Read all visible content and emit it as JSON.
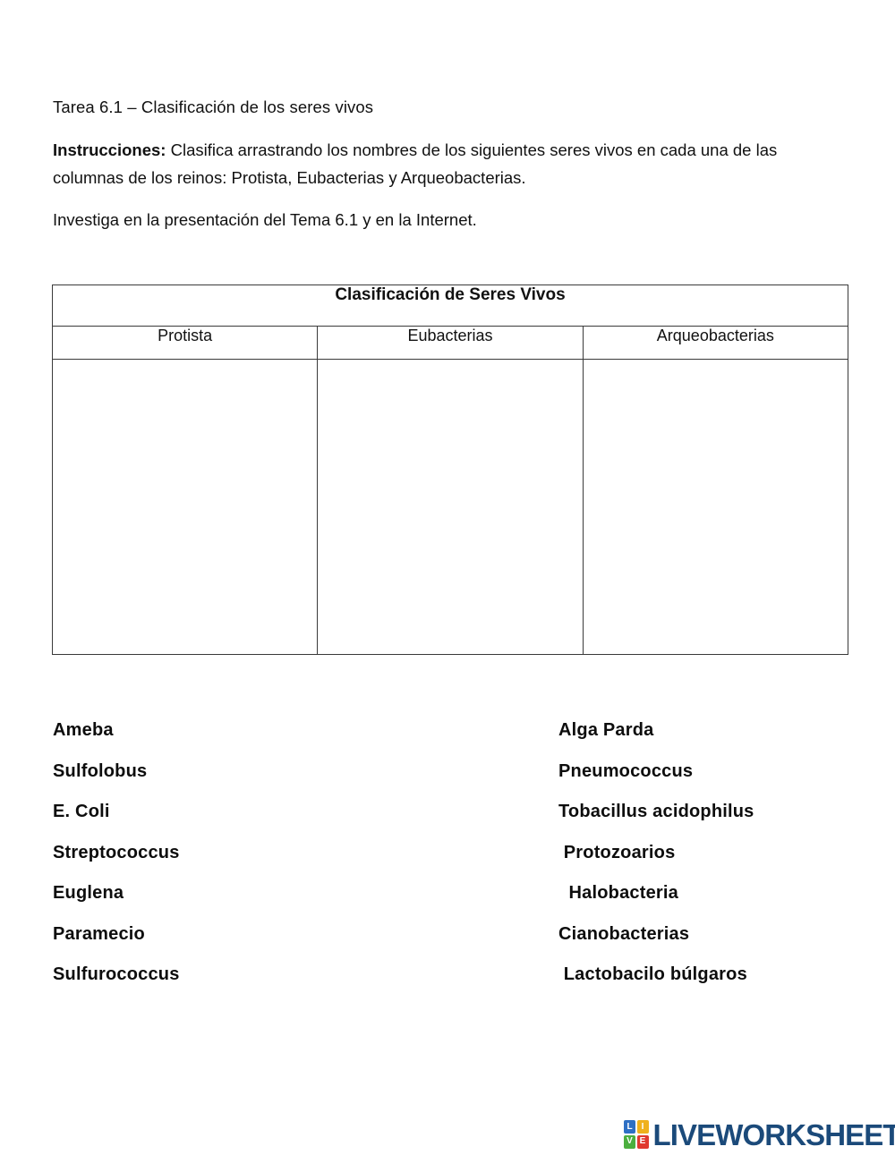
{
  "document": {
    "title": "Tarea 6.1 – Clasificación de los seres vivos",
    "instructions_label": "Instrucciones:",
    "instructions_text": " Clasifica arrastrando los nombres de los siguientes seres vivos en cada una de las columnas de los reinos: Protista, Eubacterias y Arqueobacterias.",
    "investigate_text": "Investiga en la presentación del Tema 6.1 y en la Internet."
  },
  "table": {
    "title": "Clasificación de Seres Vivos",
    "columns": [
      "Protista",
      "Eubacterias",
      "Arqueobacterias"
    ],
    "answers": [
      "",
      "",
      ""
    ]
  },
  "word_bank": {
    "left_column": [
      "Ameba",
      "Sulfolobus",
      "E. Coli",
      "Streptococcus",
      "Euglena",
      "Paramecio",
      "Sulfurococcus"
    ],
    "right_column": [
      "Alga Parda",
      "Pneumococcus",
      "Tobacillus acidophilus",
      " Protozoarios",
      "  Halobacteria",
      "Cianobacterias",
      " Lactobacilo búlgaros"
    ]
  },
  "footer": {
    "logo_letters": [
      "L",
      "I",
      "V",
      "E"
    ],
    "logo_colors": [
      "#2e6fc4",
      "#efb11d",
      "#4caf3f",
      "#e0392f"
    ],
    "wordmark": "LIVEWORKSHEETS",
    "wordmark_color": "#1b4a7a"
  },
  "theme": {
    "text_color": "#111111",
    "border_color": "#3a3a3a",
    "background": "#ffffff"
  }
}
